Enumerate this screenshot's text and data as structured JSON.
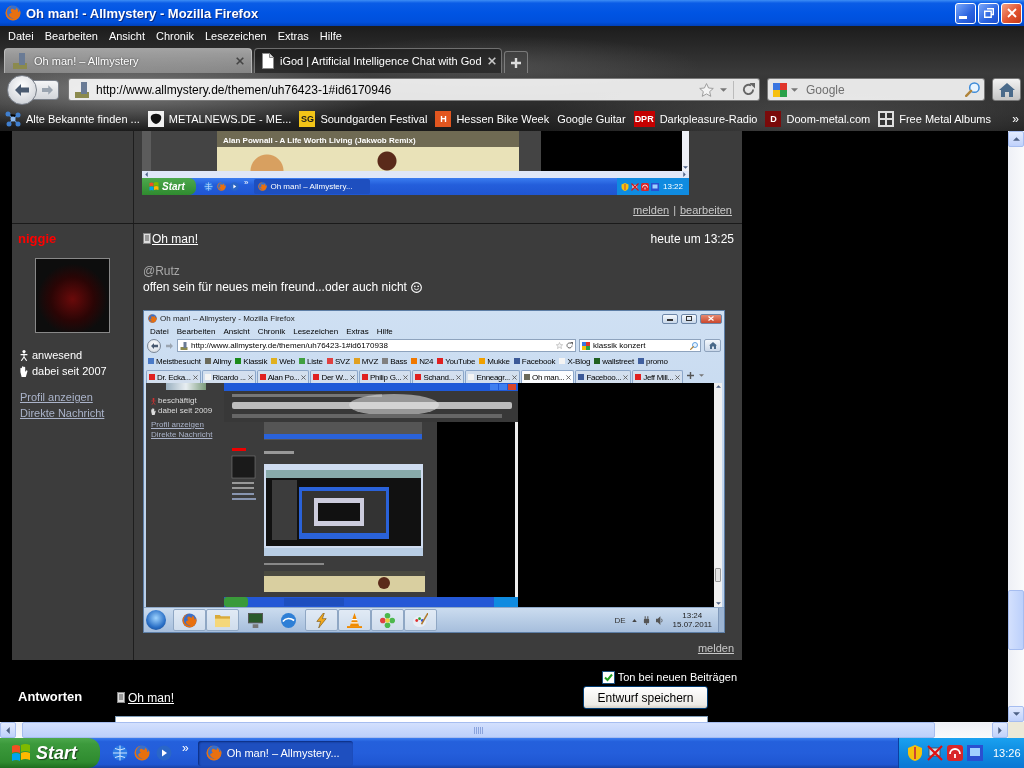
{
  "window": {
    "title": "Oh man! - Allmystery - Mozilla Firefox"
  },
  "menu": [
    "Datei",
    "Bearbeiten",
    "Ansicht",
    "Chronik",
    "Lesezeichen",
    "Extras",
    "Hilfe"
  ],
  "tabs": [
    {
      "label": "Oh man! – Allmystery",
      "kind": "forum",
      "selected": true
    },
    {
      "label": "iGod | Artificial Intelligence Chat with God",
      "kind": "page",
      "selected": false
    }
  ],
  "address_bar": {
    "url": "http://www.allmystery.de/themen/uh76423-1#id6170946"
  },
  "search": {
    "placeholder": "Google"
  },
  "bookmarks": {
    "items": [
      {
        "label": "Alte Bekannte finden ...",
        "kind": "network"
      },
      {
        "label": "METALNEWS.DE - ME...",
        "kind": "emblem"
      },
      {
        "label": "Soundgarden Festival",
        "kind": "badge",
        "badge": "SG",
        "color": "#f2c417"
      },
      {
        "label": "Hessen Bike Week",
        "kind": "badge",
        "badge": "H",
        "color": "#e2561f"
      },
      {
        "label": "Google Guitar",
        "kind": "none"
      },
      {
        "label": "Darkpleasure-Radio",
        "kind": "badge",
        "badge": "DPR",
        "color": "#c40000"
      },
      {
        "label": "Doom-metal.com",
        "kind": "badge",
        "badge": "D",
        "color": "#7a0a0a"
      },
      {
        "label": "Free Metal Albums",
        "kind": "grid"
      }
    ],
    "overflow": "»"
  },
  "previous_post": {
    "screenshot": {
      "video_title": "Alan Pownall - A Life Worth Living (Jakwob Remix)",
      "start": "Start",
      "overflow": "»",
      "task": "Oh man! – Allmystery...",
      "clock": "13:22"
    },
    "actions": [
      "melden",
      "bearbeiten"
    ],
    "separator": "|"
  },
  "post": {
    "author": "niggie",
    "status": "anwesend",
    "member_since": "dabei seit 2007",
    "profile_links": [
      "Profil anzeigen",
      "Direkte Nachricht"
    ],
    "title": "Oh man!",
    "time": "heute um 13:25",
    "mention": "@Rutz",
    "text": "offen sein für neues mein freund...oder auch nicht",
    "screenshot": {
      "title": "Oh man! – Allmystery - Mozilla Firefox",
      "menu": [
        "Datei",
        "Bearbeiten",
        "Ansicht",
        "Chronik",
        "Lesezeichen",
        "Extras",
        "Hilfe"
      ],
      "url": "http://www.allmystery.de/themen/uh76423-1#id6170938",
      "search": {
        "value": "klassik konzert"
      },
      "bookmarks": [
        {
          "label": "Meistbesucht",
          "color": "#4a7ac8"
        },
        {
          "label": "Allmy",
          "color": "#6a6a5a"
        },
        {
          "label": "Klassik",
          "color": "#1a8a1a"
        },
        {
          "label": "Web",
          "color": "#e0b020"
        },
        {
          "label": "Liste",
          "color": "#40a040"
        },
        {
          "label": "SVZ",
          "color": "#e04040"
        },
        {
          "label": "MVZ",
          "color": "#e0a020"
        },
        {
          "label": "Bass",
          "color": "#808080"
        },
        {
          "label": "N24",
          "color": "#f07800"
        },
        {
          "label": "YouTube",
          "color": "#e02020"
        },
        {
          "label": "Mukke",
          "color": "#f0a000"
        },
        {
          "label": "Facebook",
          "color": "#3b5998"
        },
        {
          "label": "X-Blog",
          "color": "#f4f4f4"
        },
        {
          "label": "wallstreet",
          "color": "#206020"
        },
        {
          "label": "promo",
          "color": "#4060a0"
        }
      ],
      "tabs": [
        {
          "label": "Dr. Ecka...",
          "color": "#e02020",
          "selected": false
        },
        {
          "label": "Ricardo ...",
          "color": "#f4f4f4",
          "selected": false
        },
        {
          "label": "Alan Po...",
          "color": "#e02020",
          "selected": false
        },
        {
          "label": "Der W...",
          "color": "#e02020",
          "selected": false
        },
        {
          "label": "Philip G...",
          "color": "#e02020",
          "selected": false
        },
        {
          "label": "Schand...",
          "color": "#e02020",
          "selected": false
        },
        {
          "label": "Enneagr...",
          "color": "#f4f4f4",
          "selected": false
        },
        {
          "label": "Oh man...",
          "color": "#6a6a5a",
          "selected": true
        },
        {
          "label": "Faceboo...",
          "color": "#3b5998",
          "selected": false
        },
        {
          "label": "Jeff Mill...",
          "color": "#e02020",
          "selected": false
        }
      ],
      "sidebar": {
        "status": "beschäftigt",
        "member_since": "dabei seit 2009",
        "links": [
          "Profil anzeigen",
          "Direkte Nachricht"
        ]
      },
      "taskbar": {
        "apps": [
          {
            "kind": "firefox",
            "running": true
          },
          {
            "kind": "folder",
            "running": true
          },
          {
            "kind": "computer",
            "running": false
          },
          {
            "kind": "swirl",
            "running": false
          },
          {
            "kind": "lightning",
            "running": true
          },
          {
            "kind": "cone",
            "running": true
          },
          {
            "kind": "flower",
            "running": true
          },
          {
            "kind": "palette",
            "running": true
          }
        ],
        "language": "DE",
        "time": "13:24",
        "date": "15.07.2011"
      }
    },
    "actions": [
      "melden"
    ]
  },
  "reply": {
    "heading": "Antworten",
    "title": "Oh man!",
    "sound_option": {
      "label": "Ton bei neuen Beiträgen",
      "checked": true
    },
    "save_button": "Entwurf speichern"
  },
  "taskbar": {
    "start": "Start",
    "overflow": "»",
    "task": "Oh man! – Allmystery...",
    "clock": "13:26"
  }
}
